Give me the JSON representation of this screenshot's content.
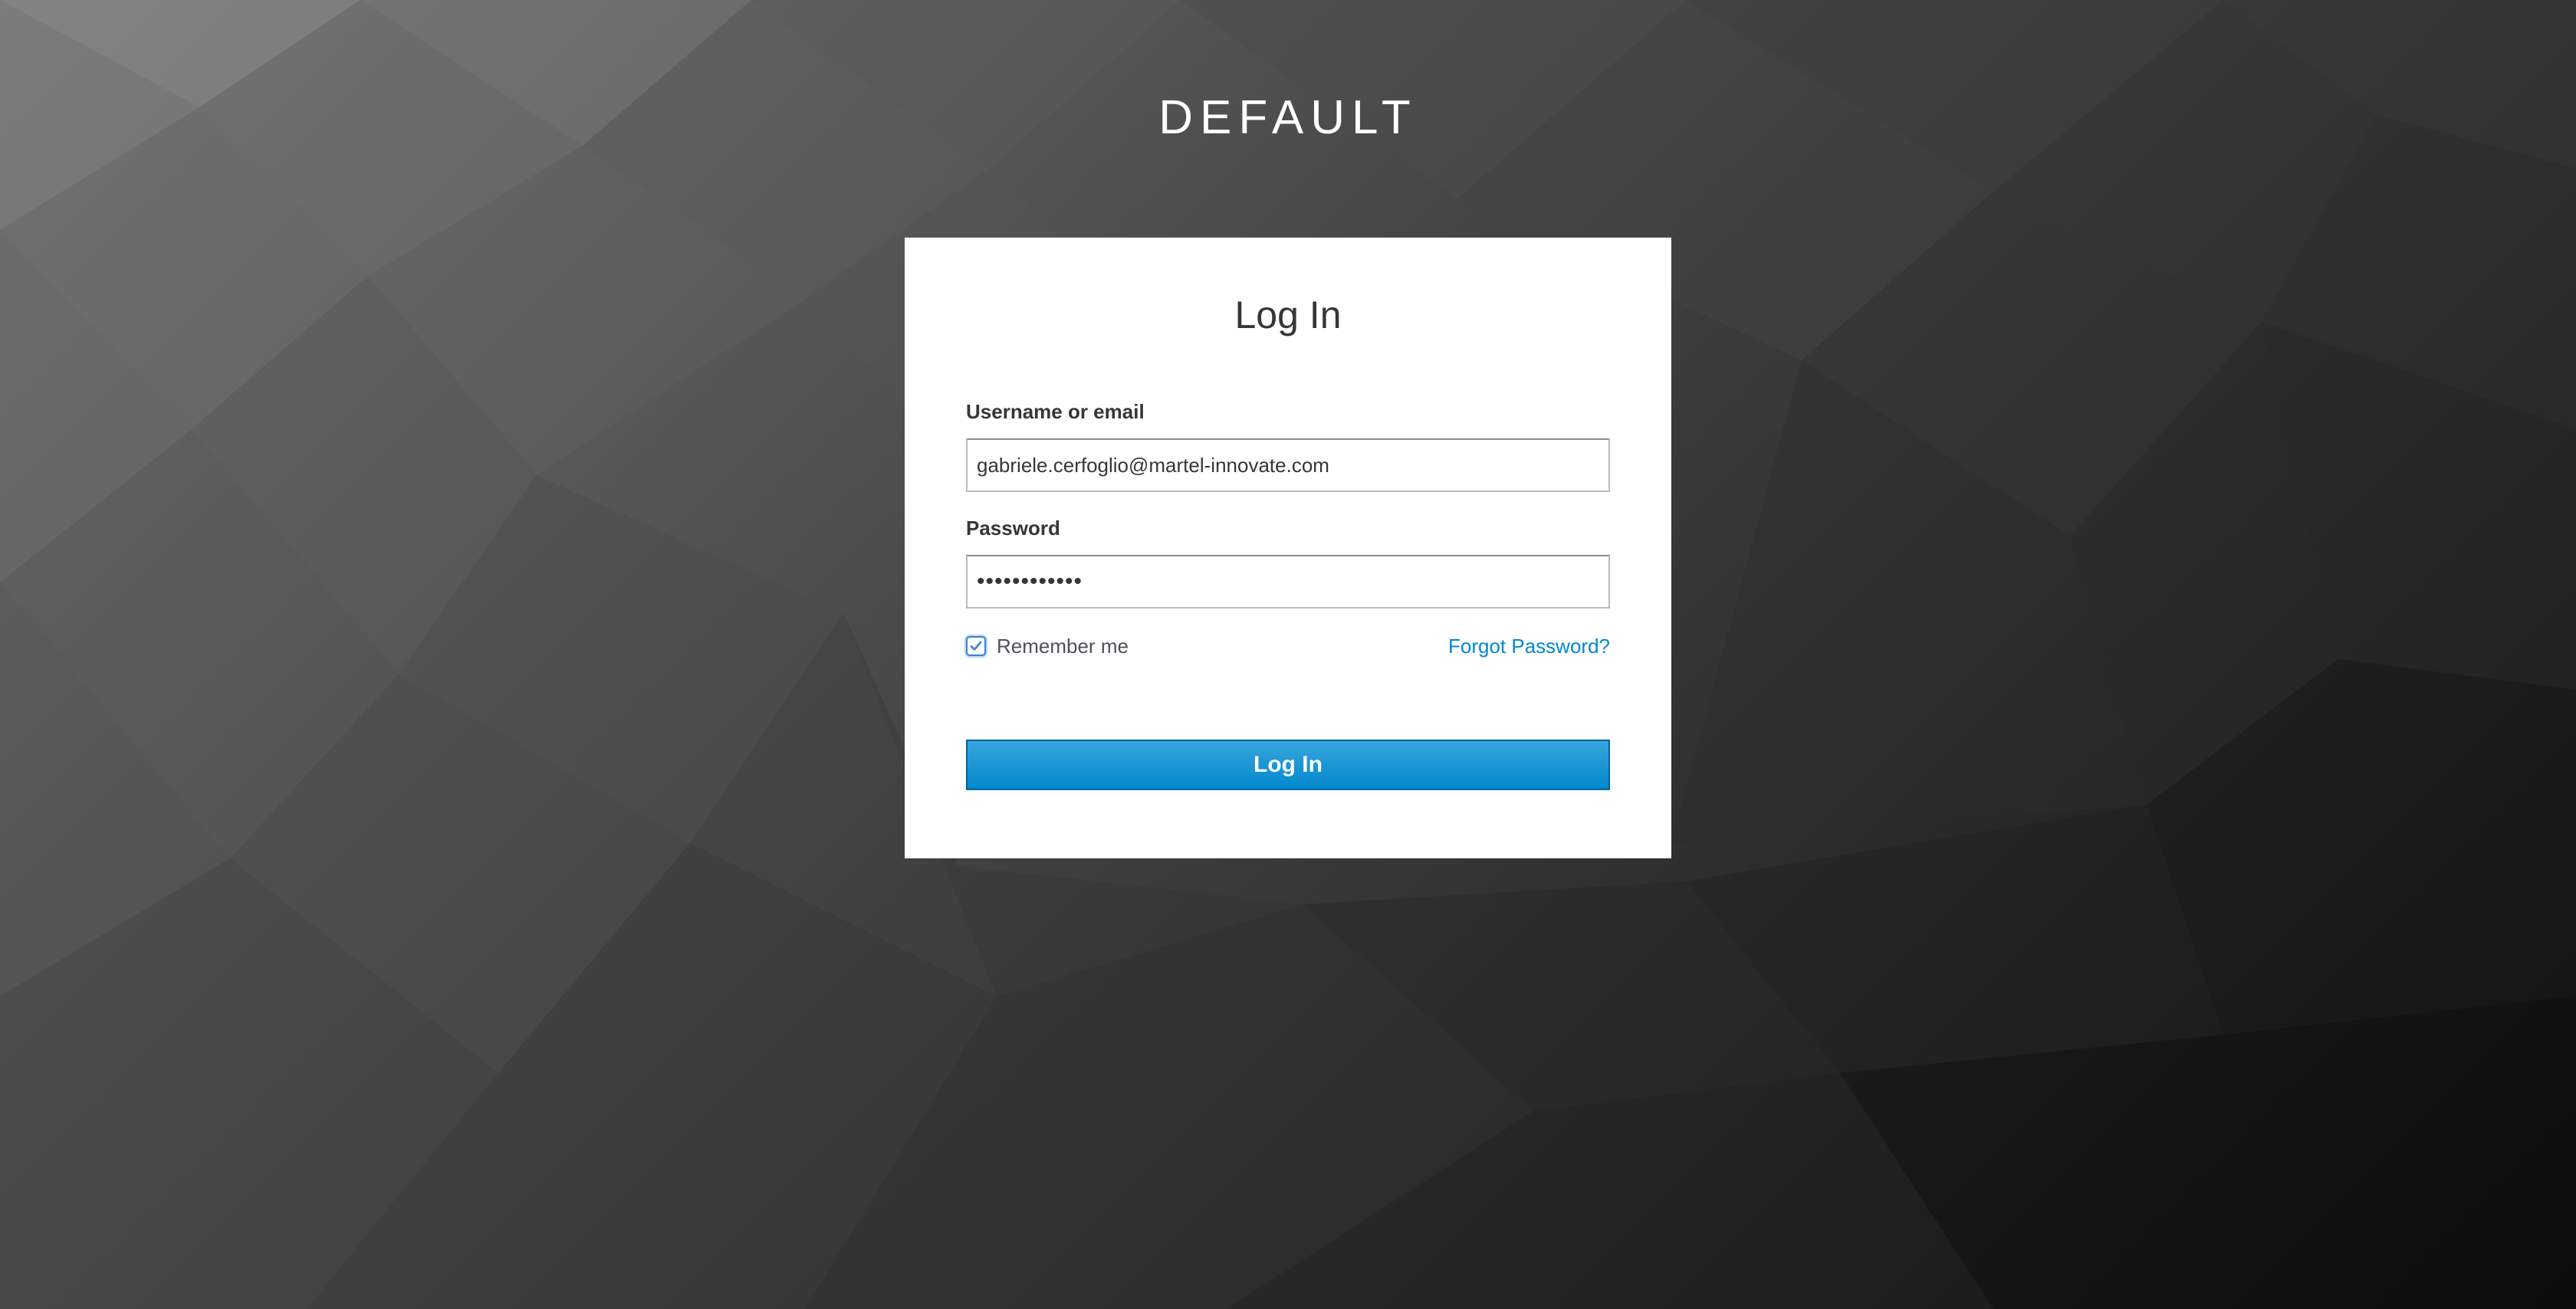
{
  "realm": {
    "title": "DEFAULT"
  },
  "login_card": {
    "title": "Log In",
    "username": {
      "label": "Username or email",
      "value": "gabriele.cerfoglio@martel-innovate.com"
    },
    "password": {
      "label": "Password",
      "value": "••••••••••••"
    },
    "remember_me": {
      "label": "Remember me",
      "checked": true
    },
    "forgot_password_link": "Forgot Password?",
    "submit_label": "Log In"
  },
  "colors": {
    "primary_button": "#0088ce",
    "link": "#0088ce",
    "checkbox_accent": "#3d7fd6"
  },
  "icons": {
    "checkbox_check": "checkmark-icon"
  }
}
